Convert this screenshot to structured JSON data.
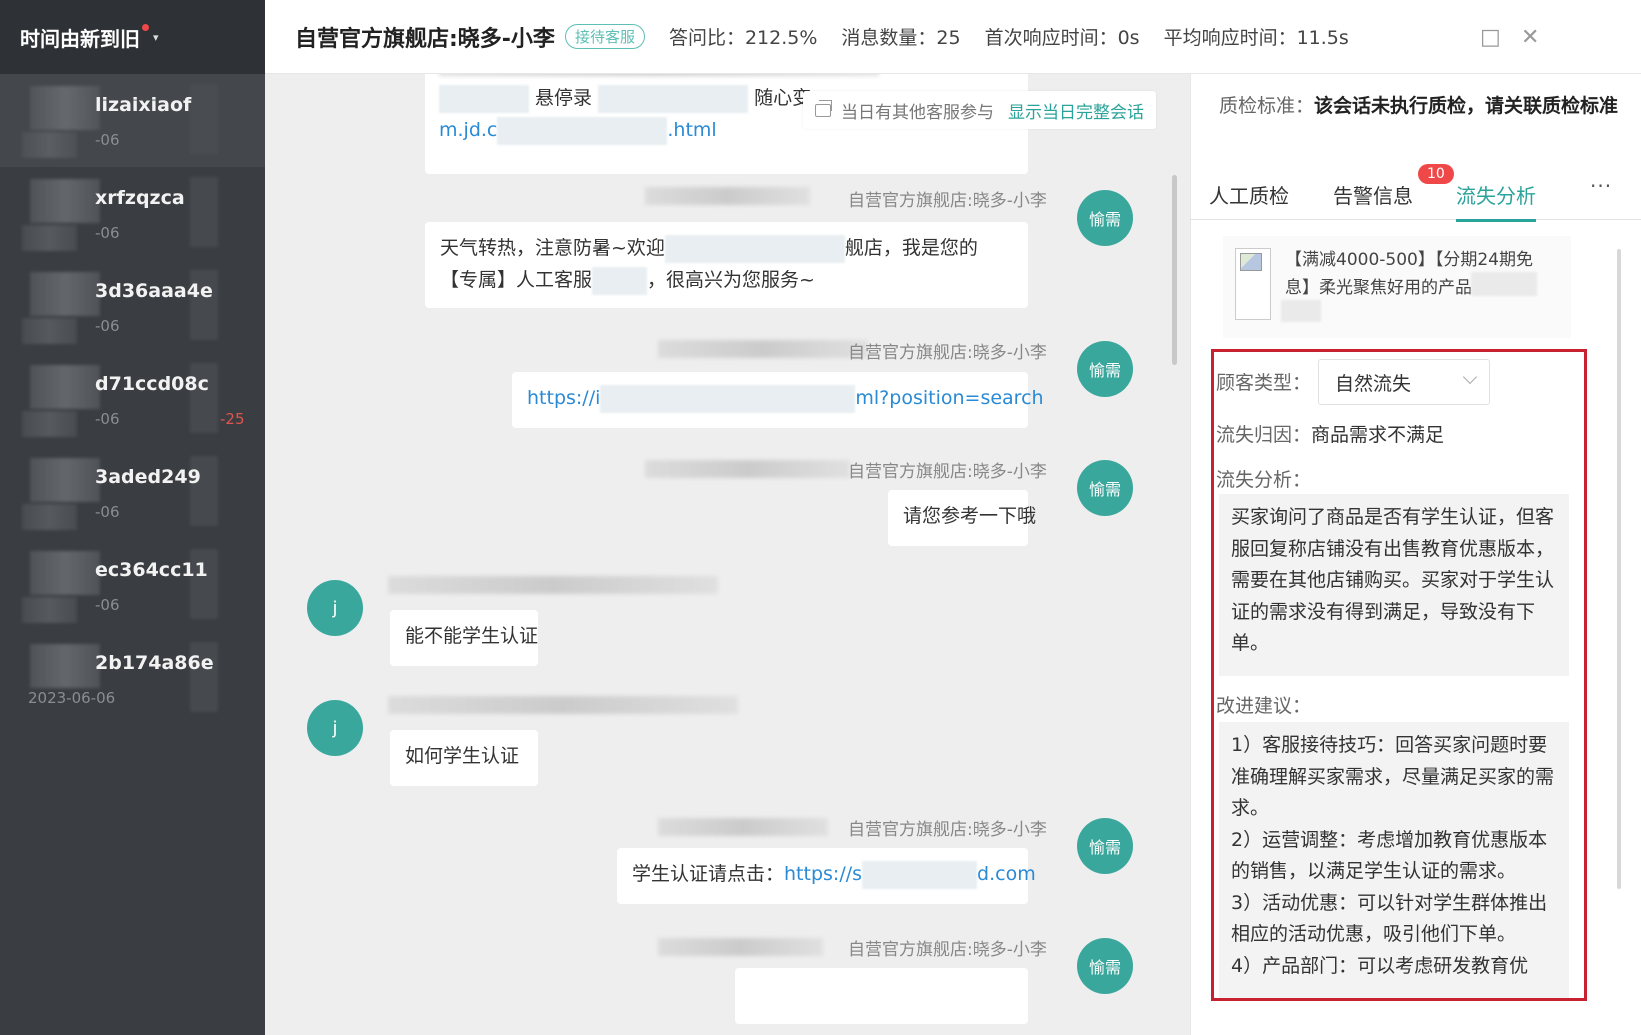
{
  "sidebar": {
    "sort_label": "时间由新到旧",
    "sessions": [
      {
        "name": "lizaixiaof",
        "date": "-06",
        "badge": ""
      },
      {
        "name": "xrfzqzca",
        "date": "-06",
        "badge": ""
      },
      {
        "name": "3d36aaa4e",
        "date": "-06",
        "badge": ""
      },
      {
        "name": "d71ccd08c",
        "date": "-06",
        "badge": "-25"
      },
      {
        "name": "3aded249",
        "date": "-06",
        "badge": ""
      },
      {
        "name": "ec364cc11",
        "date": "-06",
        "badge": ""
      },
      {
        "name": "2b174a86e",
        "date": "2023-06-06",
        "badge": ""
      }
    ]
  },
  "header": {
    "title": "自营官方旗舰店:晓多-小李",
    "tag": "接待客服",
    "stats": [
      "答问比：212.5%",
      "消息数量：25",
      "首次响应时间：0s",
      "平均响应时间：11.5s"
    ],
    "maximize_icon": "□",
    "close_icon": "✕"
  },
  "notice": {
    "text": "当日有其他客服参与",
    "action": "显示当日完整会话"
  },
  "chat": {
    "agent_name": "自营官方旗舰店:晓多-小李",
    "agent_avatar": "愉需",
    "customer_avatar": "j",
    "msg0_line1": "悬停录",
    "msg0_line1b": "随心变,",
    "msg0_link_a": "m.jd.c",
    "msg0_link_b": ".html",
    "msg1_a": "天气转热，注意防暑~欢迎",
    "msg1_b": "舰店，我是您的",
    "msg1_c": "【专属】人工客服",
    "msg1_d": "，很高兴为您服务~",
    "msg2_a": "https://i",
    "msg2_b": "ml?position=search",
    "msg3": "请您参考一下哦",
    "msg4": "能不能学生认证",
    "msg5": "如何学生认证",
    "msg6_prefix": "学生认证请点击：",
    "msg6_link_a": "https://s",
    "msg6_link_b": "d.com"
  },
  "panel": {
    "standard_label": "质检标准：",
    "standard_value": "该会话未执行质检，请关联质检标准",
    "tabs": [
      "人工质检",
      "告警信息",
      "流失分析"
    ],
    "tab_badge": "10",
    "more": "···",
    "product_text": "【满减4000-500】【分期24期免息】柔光聚焦好用的产品 主",
    "customer_type_label": "顾客类型：",
    "customer_type_value": "自然流失",
    "cause_label": "流失归因：",
    "cause_value": "商品需求不满足",
    "analysis_label": "流失分析：",
    "analysis_text": "买家询问了商品是否有学生认证，但客服回复称店铺没有出售教育优惠版本，需要在其他店铺购买。买家对于学生认证的需求没有得到满足，导致没有下单。",
    "suggest_label": "改进建议：",
    "suggest_1": "1）客服接待技巧：回答买家问题时要准确理解买家需求，尽量满足买家的需求。",
    "suggest_2": "2）运营调整：考虑增加教育优惠版本的销售，以满足学生认证的需求。",
    "suggest_3": "3）活动优惠：可以针对学生群体推出相应的活动优惠，吸引他们下单。",
    "suggest_4": "4）产品部门：可以考虑研发教育优"
  },
  "colors": {
    "accent": "#2aa39a",
    "sidebar_bg": "#3a3d41",
    "highlight_border": "#c8212f",
    "badge_red": "#f04848",
    "link": "#2a8ad4"
  }
}
